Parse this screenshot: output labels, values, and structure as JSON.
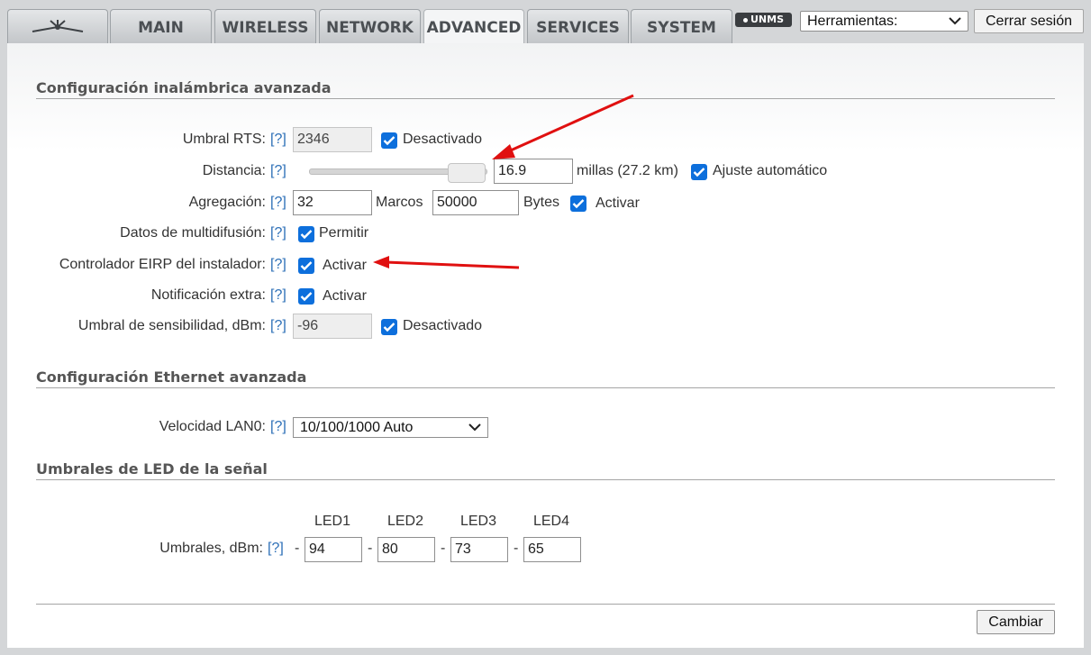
{
  "tabs": [
    {
      "label": "",
      "icon": "ubiquiti-logo-icon"
    },
    {
      "label": "MAIN"
    },
    {
      "label": "WIRELESS"
    },
    {
      "label": "NETWORK"
    },
    {
      "label": "ADVANCED",
      "active": true
    },
    {
      "label": "SERVICES"
    },
    {
      "label": "SYSTEM"
    }
  ],
  "header": {
    "unms_badge": "UNMS",
    "tools_select": "Herramientas:",
    "logout_label": "Cerrar sesión"
  },
  "help_label": "[?]",
  "wireless": {
    "title": "Configuración inalámbrica avanzada",
    "rts": {
      "label": "Umbral RTS:",
      "value": "2346",
      "check_label": "Desactivado",
      "checked": true
    },
    "distance": {
      "label": "Distancia:",
      "value": "16.9",
      "units": "millas (27.2 km)",
      "check_label": "Ajuste automático",
      "checked": true,
      "slider_level_pct": 100
    },
    "aggregation": {
      "label": "Agregación:",
      "frames": "32",
      "frames_label": "Marcos",
      "bytes": "50000",
      "bytes_label": "Bytes",
      "check_label": "Activar",
      "checked": true
    },
    "multicast": {
      "label": "Datos de multidifusión:",
      "check_label": "Permitir",
      "checked": true
    },
    "eirp": {
      "label": "Controlador EIRP del instalador:",
      "check_label": "Activar",
      "checked": true
    },
    "extra_notif": {
      "label": "Notificación extra:",
      "check_label": "Activar",
      "checked": true
    },
    "sensitivity": {
      "label": "Umbral de sensibilidad, dBm:",
      "value": "-96",
      "check_label": "Desactivado",
      "checked": true
    }
  },
  "ethernet": {
    "title": "Configuración Ethernet avanzada",
    "lan0": {
      "label": "Velocidad LAN0:",
      "value": "10/100/1000 Auto"
    }
  },
  "led": {
    "title": "Umbrales de LED de la señal",
    "headers": [
      "LED1",
      "LED2",
      "LED3",
      "LED4"
    ],
    "label": "Umbrales, dBm:",
    "dash": "-",
    "values": [
      "94",
      "80",
      "73",
      "65"
    ]
  },
  "apply_label": "Cambiar",
  "colors": {
    "accent_check": "#0d6fdc",
    "help_link": "#2c6fb7",
    "annotation_arrow": "#e01010"
  }
}
